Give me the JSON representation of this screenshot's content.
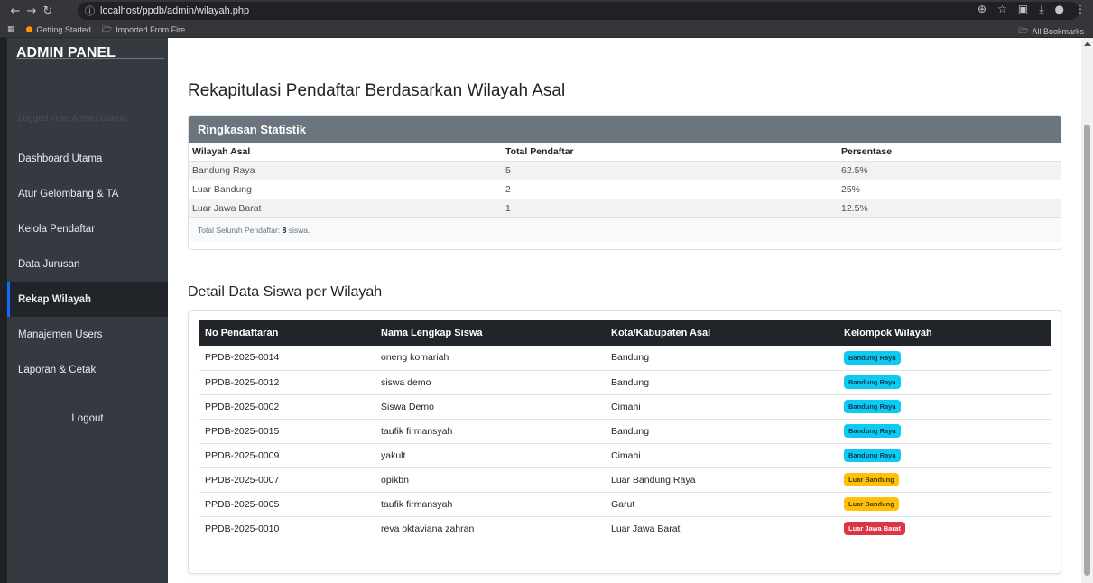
{
  "browser": {
    "url": "localhost/ppdb/admin/wilayah.php",
    "bookmarks": [
      "Getting Started",
      "Imported From Fire..."
    ],
    "all_bookmarks": "All Bookmarks"
  },
  "sidebar": {
    "brand": "ADMIN PANEL",
    "tagline": "Logged in as Admin Utama",
    "items": [
      {
        "label": "Dashboard Utama"
      },
      {
        "label": "Atur Gelombang & TA"
      },
      {
        "label": "Kelola Pendaftar"
      },
      {
        "label": "Data Jurusan"
      },
      {
        "label": "Rekap Wilayah"
      },
      {
        "label": "Manajemen Users"
      },
      {
        "label": "Laporan & Cetak"
      }
    ],
    "logout": "Logout"
  },
  "main": {
    "title": "Rekapitulasi Pendaftar Berdasarkan Wilayah Asal",
    "summary": {
      "header": "Ringkasan Statistik",
      "columns": [
        "Wilayah Asal",
        "Total Pendaftar",
        "Persentase"
      ],
      "rows": [
        [
          "Bandung Raya",
          "5",
          "62.5%"
        ],
        [
          "Luar Bandung",
          "2",
          "25%"
        ],
        [
          "Luar Jawa Barat",
          "1",
          "12.5%"
        ]
      ],
      "footer_prefix": "Total Seluruh Pendaftar:",
      "footer_count": "8",
      "footer_suffix": "siswa."
    },
    "detail": {
      "title": "Detail Data Siswa per Wilayah",
      "columns": [
        "No Pendaftaran",
        "Nama Lengkap Siswa",
        "Kota/Kabupaten Asal",
        "Kelompok Wilayah"
      ],
      "rows": [
        [
          "PPDB-2025-0014",
          "oneng komariah",
          "Bandung",
          "Bandung Raya"
        ],
        [
          "PPDB-2025-0012",
          "siswa demo",
          "Bandung",
          "Bandung Raya"
        ],
        [
          "PPDB-2025-0002",
          "Siswa Demo",
          "Cimahi",
          "Bandung Raya"
        ],
        [
          "PPDB-2025-0015",
          "taufik firmansyah",
          "Bandung",
          "Bandung Raya"
        ],
        [
          "PPDB-2025-0009",
          "yakult",
          "Cimahi",
          "Bandung Raya"
        ],
        [
          "PPDB-2025-0007",
          "opikbn",
          "Luar Bandung Raya",
          "Luar Bandung"
        ],
        [
          "PPDB-2025-0005",
          "taufik firmansyah",
          "Garut",
          "Luar Bandung"
        ],
        [
          "PPDB-2025-0010",
          "reva oktaviana zahran",
          "Luar Jawa Barat",
          "Luar Jawa Barat"
        ]
      ]
    }
  },
  "colors": {
    "sidebar_bg": "#343a40",
    "active_bg": "#212529",
    "badge_bandung_raya": "#0dcaf0",
    "badge_luar_bandung": "#ffc107",
    "badge_luar_jabar": "#dc3545"
  }
}
